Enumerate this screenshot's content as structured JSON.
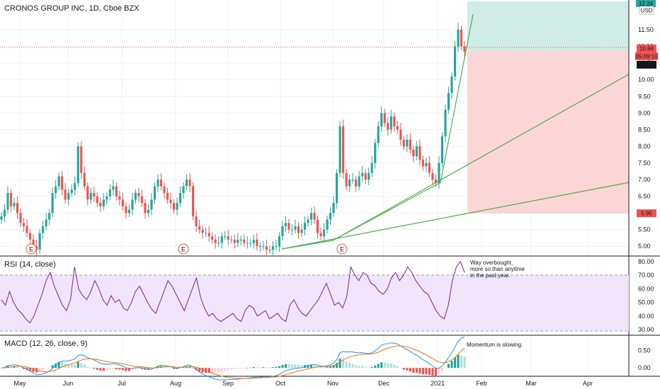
{
  "header": {
    "title": "CRONOS GROUP INC, 1D, Cboe BZX",
    "currency": "USD"
  },
  "axes": {
    "price_ticks": [
      "11.50",
      "11.00",
      "10.50",
      "10.00",
      "9.50",
      "9.00",
      "8.50",
      "8.00",
      "7.50",
      "7.00",
      "6.50",
      "6.00",
      "5.50",
      "5.00"
    ],
    "price_tick_values": [
      11.5,
      11.0,
      10.5,
      10.0,
      9.5,
      9.0,
      8.5,
      8.0,
      7.5,
      7.0,
      6.5,
      6.0,
      5.5,
      5.0
    ],
    "rsi_ticks": [
      "80.00",
      "70.00",
      "60.00",
      "50.00",
      "40.00",
      "30.00"
    ],
    "rsi_tick_values": [
      80,
      70,
      60,
      50,
      40,
      30
    ],
    "macd_ticks": [
      "0.50",
      "0.00"
    ],
    "macd_tick_values": [
      0.5,
      0.0
    ],
    "dates": [
      "May",
      "Jun",
      "Jul",
      "Aug",
      "Sep",
      "Oct",
      "Nov",
      "Dec",
      "2021",
      "Feb",
      "Mar",
      "Apr"
    ]
  },
  "price_badges": {
    "target": "12.24",
    "last": "10.84",
    "countdown": "05:09:10",
    "prev": "10.78",
    "stop": "5.95"
  },
  "colors": {
    "up": "#26a69a",
    "down": "#ef5350",
    "trendline": "#4caf50",
    "rsi_line": "#7b1fa2",
    "rsi_band": "#f1e5fb",
    "macd_line": "#2196f3",
    "signal_line": "#ff6d00",
    "target_zone": "#cfece7",
    "stop_zone": "#fcd6d6"
  },
  "panes": {
    "rsi_label": "RSI (14, close)",
    "macd_label": "MACD (12, 26, close, 9)"
  },
  "annotations": {
    "rsi_note": [
      "Way overbought,",
      "more so than anytime",
      "in the past year."
    ],
    "macd_note": "Momentum is slowing.",
    "earnings_marker": "E"
  },
  "chart_data": {
    "type": "candlestick",
    "title": "CRONOS GROUP INC, 1D, Cboe BZX",
    "candles_close": [
      5.9,
      6.1,
      6.6,
      6.2,
      6.3,
      6.0,
      5.7,
      5.6,
      5.4,
      5.2,
      5.0,
      4.9,
      5.4,
      5.6,
      5.8,
      6.0,
      6.6,
      6.8,
      7.1,
      6.7,
      6.4,
      6.6,
      6.7,
      6.9,
      8.0,
      7.2,
      6.8,
      6.4,
      6.6,
      6.5,
      6.3,
      6.2,
      6.4,
      6.5,
      6.7,
      6.8,
      6.5,
      6.4,
      6.2,
      6.0,
      6.1,
      6.4,
      6.6,
      6.5,
      6.3,
      6.0,
      6.1,
      6.4,
      6.8,
      7.0,
      6.8,
      6.6,
      6.4,
      6.3,
      6.1,
      6.3,
      6.6,
      6.8,
      7.0,
      6.8,
      5.9,
      5.6,
      5.5,
      5.4,
      5.4,
      5.3,
      5.2,
      5.1,
      5.1,
      5.3,
      5.3,
      5.2,
      5.2,
      5.1,
      5.2,
      5.2,
      5.1,
      5.1,
      5.1,
      5.2,
      5.0,
      5.0,
      5.0,
      4.9,
      4.9,
      5.0,
      5.0,
      5.3,
      5.6,
      5.7,
      5.5,
      5.5,
      5.6,
      5.4,
      5.5,
      5.7,
      5.8,
      6.0,
      5.8,
      5.4,
      5.3,
      5.5,
      5.8,
      6.0,
      6.3,
      7.2,
      8.6,
      7.2,
      6.8,
      7.0,
      7.0,
      6.8,
      7.1,
      7.2,
      7.0,
      7.2,
      7.5,
      8.1,
      8.6,
      9.0,
      8.7,
      8.5,
      8.9,
      8.6,
      8.5,
      8.2,
      8.0,
      8.2,
      7.9,
      7.7,
      8.0,
      7.6,
      7.4,
      7.5,
      7.2,
      7.0,
      6.9,
      7.5,
      8.3,
      9.1,
      9.6,
      10.1,
      11.0,
      11.5,
      11.0,
      10.84
    ],
    "rsi": [
      52,
      48,
      58,
      50,
      45,
      42,
      38,
      35,
      40,
      48,
      56,
      66,
      72,
      62,
      55,
      48,
      44,
      52,
      76,
      60,
      55,
      52,
      58,
      66,
      60,
      52,
      48,
      55,
      50,
      52,
      46,
      44,
      50,
      58,
      62,
      56,
      50,
      45,
      42,
      50,
      58,
      66,
      62,
      56,
      50,
      44,
      52,
      60,
      68,
      54,
      46,
      40,
      42,
      38,
      36,
      38,
      40,
      42,
      38,
      36,
      44,
      48,
      46,
      40,
      42,
      44,
      38,
      40,
      42,
      38,
      36,
      48,
      52,
      46,
      42,
      40,
      44,
      48,
      52,
      58,
      64,
      56,
      48,
      50,
      46,
      54,
      76,
      70,
      66,
      72,
      70,
      64,
      62,
      58,
      56,
      60,
      68,
      72,
      66,
      70,
      76,
      72,
      66,
      62,
      58,
      56,
      50,
      44,
      40,
      38,
      48,
      66,
      76,
      80,
      72
    ],
    "rsi_overbought": 70,
    "rsi_oversold": 30,
    "macd_ylim": [
      -0.2,
      0.9
    ],
    "price_ylim": [
      4.75,
      12.35
    ],
    "rsi_ylim": [
      27,
      83
    ],
    "grid": true,
    "legend": "top-left"
  }
}
